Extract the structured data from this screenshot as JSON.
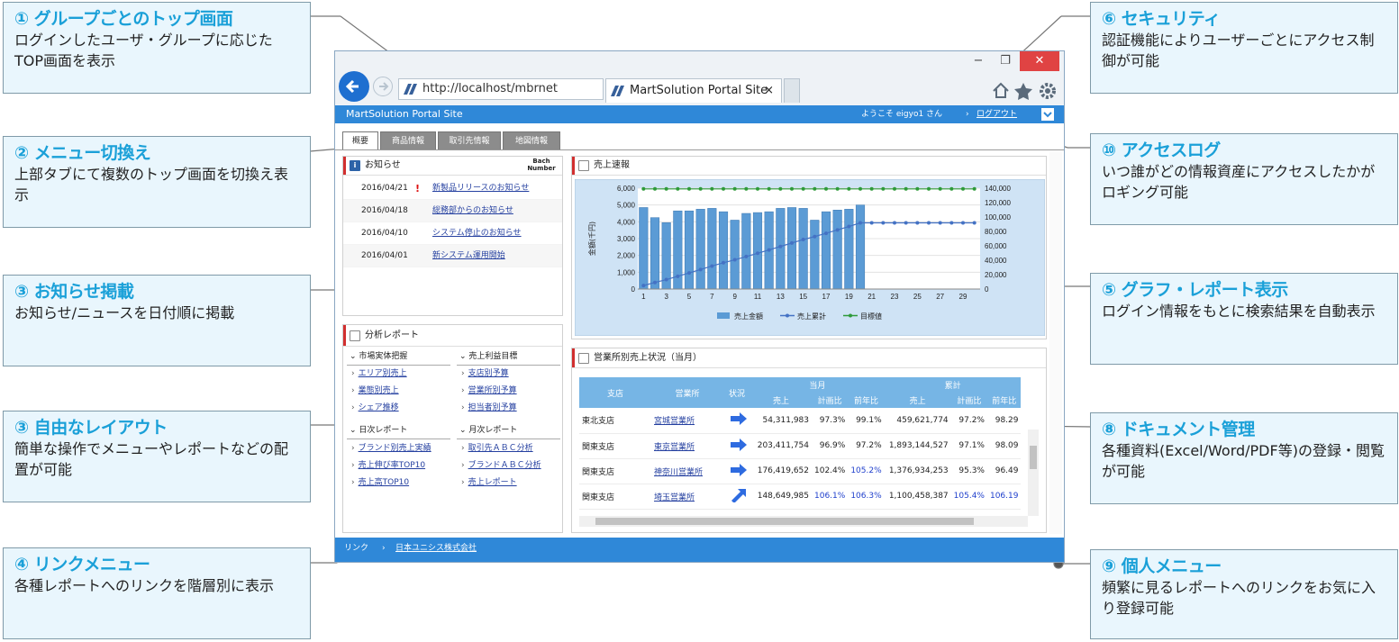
{
  "callouts": [
    {
      "title": "① グループごとのトップ画面",
      "body": "ログインしたユーザ・グループに応じたTOP画面を表示"
    },
    {
      "title": "② メニュー切換え",
      "body": "上部タブにて複数のトップ画面を切換え表示"
    },
    {
      "title": "③ お知らせ掲載",
      "body": "お知らせ/ニュースを日付順に掲載"
    },
    {
      "title": "③ 自由なレイアウト",
      "body": "簡単な操作でメニューやレポートなどの配置が可能"
    },
    {
      "title": "④ リンクメニュー",
      "body": "各種レポートへのリンクを階層別に表示"
    },
    {
      "title": "⑥ セキュリティ",
      "body": "認証機能によりユーザーごとにアクセス制御が可能"
    },
    {
      "title": "⑩ アクセスログ",
      "body": "いつ誰がどの情報資産にアクセスしたかがロギング可能"
    },
    {
      "title": "⑤ グラフ・レポート表示",
      "body": "ログイン情報をもとに検索結果を自動表示"
    },
    {
      "title": "⑧ ドキュメント管理",
      "body": "各種資料(Excel/Word/PDF等)の登録・閲覧が可能"
    },
    {
      "title": "⑨ 個人メニュー",
      "body": "頻繁に見るレポートへのリンクをお気に入り登録可能"
    }
  ],
  "browser": {
    "address": "http://localhost/mbrnet",
    "tab_title": "MartSolution Portal Site",
    "tab_close": "×",
    "minimize": "−",
    "restore": "❐",
    "close": "✕"
  },
  "portal": {
    "site_title": "MartSolution Portal Site",
    "welcome": "ようこそ eigyo1 さん",
    "logout": "ログアウト",
    "tabs": [
      "概要",
      "商品情報",
      "取引先情報",
      "地図情報"
    ],
    "notices_title": "お知らせ",
    "notices_logo": "Bach Number",
    "notices": [
      {
        "date": "2016/04/21",
        "important": "!",
        "text": "新製品リリースのお知らせ"
      },
      {
        "date": "2016/04/18",
        "important": "",
        "text": "総務部からのお知らせ"
      },
      {
        "date": "2016/04/10",
        "important": "",
        "text": "システム停止のお知らせ"
      },
      {
        "date": "2016/04/01",
        "important": "",
        "text": "新システム運用開始"
      }
    ],
    "reports_title": "分析レポート",
    "report_sections": [
      {
        "title": "市場実体把握",
        "items": [
          "エリア別売上",
          "業態別売上",
          "シェア推移"
        ]
      },
      {
        "title": "売上利益目標",
        "items": [
          "支店別予算",
          "営業所別予算",
          "担当者別予算"
        ]
      },
      {
        "title": "日次レポート",
        "items": [
          "ブランド別売上実績",
          "売上伸び率TOP10",
          "売上高TOP10"
        ]
      },
      {
        "title": "月次レポート",
        "items": [
          "取引先ＡＢＣ分析",
          "ブランドＡＢＣ分析",
          "売上レポート"
        ]
      }
    ],
    "chart_title": "売上速報",
    "table_title": "営業所別売上状況（当月）",
    "table": {
      "headers": {
        "branch": "支店",
        "office": "営業所",
        "status": "状況",
        "current": "当月",
        "cumulative": "累計",
        "sales": "売上",
        "plan": "計画比",
        "yoy": "前年比"
      },
      "rows": [
        {
          "branch": "東北支店",
          "office": "宮城営業所",
          "sales": "54,311,983",
          "plan": "97.3%",
          "yoy": "99.1%",
          "csales": "459,621,774",
          "cplan": "97.2%",
          "cyoy": "98.29"
        },
        {
          "branch": "関東支店",
          "office": "東京営業所",
          "sales": "203,411,754",
          "plan": "96.9%",
          "yoy": "97.2%",
          "csales": "1,893,144,527",
          "cplan": "97.1%",
          "cyoy": "98.09"
        },
        {
          "branch": "関東支店",
          "office": "神奈川営業所",
          "sales": "176,419,652",
          "plan": "102.4%",
          "yoy": "105.2%",
          "csales": "1,376,934,253",
          "cplan": "95.3%",
          "cyoy": "96.49"
        },
        {
          "branch": "関東支店",
          "office": "埼玉営業所",
          "sales": "148,649,985",
          "plan": "106.1%",
          "yoy": "106.3%",
          "csales": "1,100,458,387",
          "cplan": "105.4%",
          "cyoy": "106.19"
        }
      ]
    },
    "footer_label": "リンク",
    "footer_link": "日本ユニシス株式会社"
  },
  "chart_data": {
    "type": "bar",
    "title": "",
    "x": [
      1,
      2,
      3,
      4,
      5,
      6,
      7,
      8,
      9,
      10,
      11,
      12,
      13,
      14,
      15,
      16,
      17,
      18,
      19,
      20,
      21,
      22,
      23,
      24,
      25,
      26,
      27,
      28,
      29,
      30
    ],
    "x_tick_labels": [
      "1",
      "3",
      "5",
      "7",
      "9",
      "11",
      "13",
      "15",
      "17",
      "19",
      "21",
      "23",
      "25",
      "27",
      "29"
    ],
    "ylabel": "金額(千円)",
    "ylim": [
      0,
      6000
    ],
    "y_ticks": [
      "0",
      "1,000",
      "2,000",
      "3,000",
      "4,000",
      "5,000",
      "6,000"
    ],
    "y2lim": [
      0,
      140000
    ],
    "y2_ticks": [
      "0",
      "20,000",
      "40,000",
      "60,000",
      "80,000",
      "100,000",
      "120,000",
      "140,000"
    ],
    "legend_position": "bottom",
    "grid": true,
    "colors": {
      "bars": "#5b9bd5",
      "cumulative": "#4472c4",
      "target": "#2e9a3a"
    },
    "series": [
      {
        "name": "売上金額",
        "axis": "left",
        "values": [
          4850,
          4250,
          3950,
          4650,
          4650,
          4750,
          4800,
          4600,
          4100,
          4500,
          4550,
          4600,
          4800,
          4850,
          4800,
          4100,
          4600,
          4700,
          4750,
          5000
        ]
      },
      {
        "name": "売上累計",
        "axis": "right",
        "values": [
          4850,
          9100,
          13050,
          17700,
          22350,
          27100,
          31900,
          36500,
          40600,
          45100,
          49650,
          54250,
          59050,
          63900,
          68700,
          72800,
          77400,
          82100,
          86850,
          91850,
          91850,
          91850,
          91850,
          91850,
          91850,
          91850,
          91850,
          91850,
          91850,
          91850
        ]
      },
      {
        "name": "目標値",
        "axis": "right",
        "values": [
          139000,
          139000,
          139000,
          139000,
          139000,
          139000,
          139000,
          139000,
          139000,
          139000,
          139000,
          139000,
          139000,
          139000,
          139000,
          139000,
          139000,
          139000,
          139000,
          139000,
          139000,
          139000,
          139000,
          139000,
          139000,
          139000,
          139000,
          139000,
          139000,
          139000
        ]
      }
    ]
  }
}
